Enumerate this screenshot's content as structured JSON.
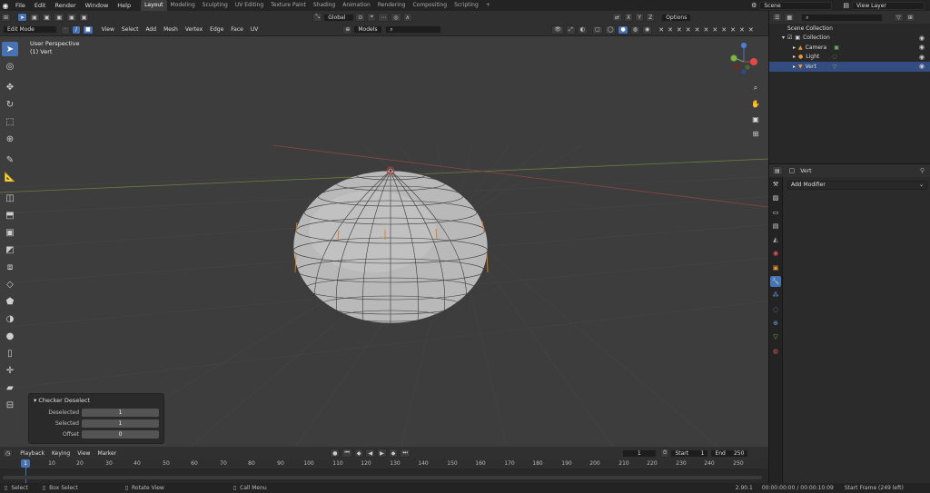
{
  "topbar": {
    "menu": [
      "File",
      "Edit",
      "Render",
      "Window",
      "Help"
    ],
    "workspaces": [
      "Layout",
      "Modeling",
      "Sculpting",
      "UV Editing",
      "Texture Paint",
      "Shading",
      "Animation",
      "Rendering",
      "Compositing",
      "Scripting",
      "+"
    ],
    "active_workspace": "Layout",
    "scene": "Scene",
    "view_layer": "View Layer"
  },
  "viewport_header": {
    "mode": "Edit Mode",
    "menus": [
      "View",
      "Select",
      "Add",
      "Mesh",
      "Vertex",
      "Edge",
      "Face",
      "UV"
    ],
    "transform_orientation": "Global",
    "options": "Options",
    "axes": [
      "X",
      "Y",
      "Z"
    ],
    "snap_target": "Models"
  },
  "viewport": {
    "perspective": "User Perspective",
    "object": "(1) Vert"
  },
  "operator_panel": {
    "title": "Checker Deselect",
    "fields": [
      {
        "label": "Deselected",
        "value": "1"
      },
      {
        "label": "Selected",
        "value": "1"
      },
      {
        "label": "Offset",
        "value": "0"
      }
    ]
  },
  "timeline": {
    "menus": [
      "Playback",
      "Keying",
      "View",
      "Marker"
    ],
    "current_frame": "1",
    "start_label": "Start",
    "start": "1",
    "end_label": "End",
    "end": "250",
    "ticks": [
      "1",
      "10",
      "20",
      "30",
      "40",
      "50",
      "60",
      "70",
      "80",
      "90",
      "100",
      "110",
      "120",
      "130",
      "140",
      "150",
      "160",
      "170",
      "180",
      "190",
      "200",
      "210",
      "220",
      "230",
      "240",
      "250"
    ]
  },
  "statusbar": {
    "select": "Select",
    "box_select": "Box Select",
    "rotate_view": "Rotate View",
    "call_menu": "Call Menu",
    "version": "2.90.1",
    "time": "00:00:00:00 / 00:00:10:09",
    "frame": "Start Frame (249 left)"
  },
  "outliner": {
    "root": "Scene Collection",
    "collection": "Collection",
    "items": [
      "Camera",
      "Light",
      "Vert"
    ]
  },
  "properties": {
    "object_name": "Vert",
    "add_modifier": "Add Modifier"
  }
}
